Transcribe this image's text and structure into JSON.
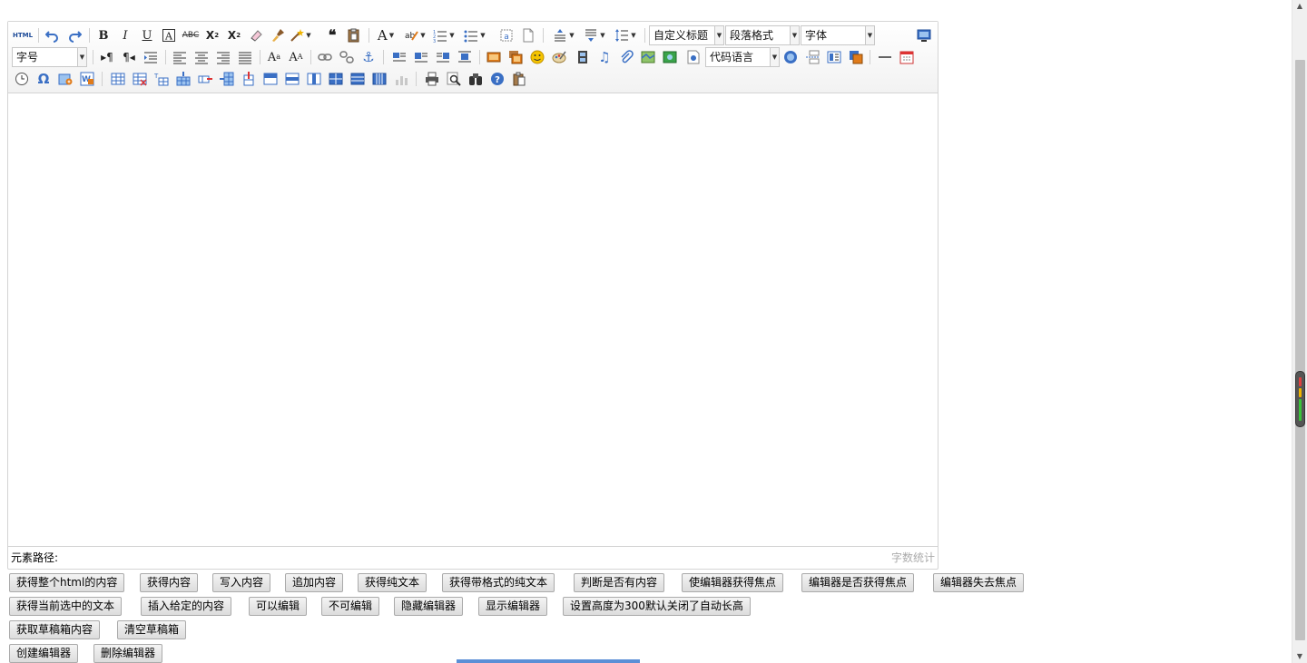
{
  "toolbar": {
    "row1": {
      "html_source": "HTML",
      "heading_select": "自定义标题",
      "paragraph_select": "段落格式",
      "font_select": "字体"
    },
    "row2": {
      "font_size_select": "字号",
      "code_language_select": "代码语言"
    }
  },
  "status_bar": {
    "element_path_label": "元素路径:",
    "word_count_label": "字数统计"
  },
  "buttons": {
    "row1": [
      "获得整个html的内容",
      "获得内容",
      "写入内容",
      "追加内容",
      "获得纯文本",
      "获得带格式的纯文本",
      "判断是否有内容",
      "使编辑器获得焦点",
      "编辑器是否获得焦点",
      "编辑器失去焦点"
    ],
    "row2": [
      "获得当前选中的文本",
      "插入给定的内容",
      "可以编辑",
      "不可编辑",
      "隐藏编辑器",
      "显示编辑器",
      "设置高度为300默认关闭了自动长高"
    ],
    "row3": [
      "获取草稿箱内容",
      "清空草稿箱"
    ],
    "row4": [
      "创建编辑器",
      "删除编辑器"
    ]
  },
  "colors": {
    "icon_blue": "#3a6fc4",
    "icon_orange": "#e07b1a",
    "button_border": "#aaaaaa",
    "editor_border": "#d4d4d4"
  }
}
